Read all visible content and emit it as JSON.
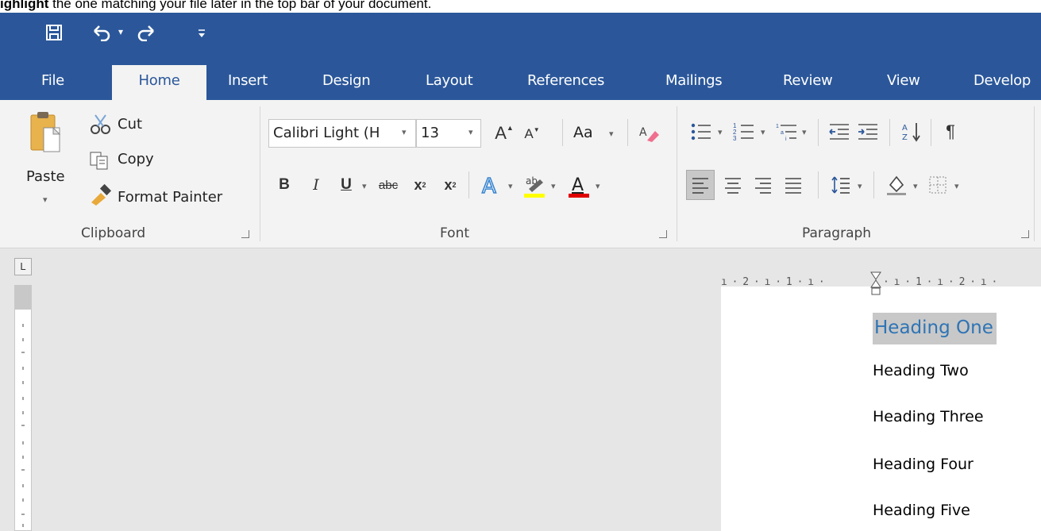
{
  "caption": {
    "bold": "ighlight",
    "rest": " the one matching your file later in the top bar of your document."
  },
  "qat": {
    "items": [
      {
        "name": "save-icon"
      },
      {
        "name": "undo-icon"
      },
      {
        "name": "redo-icon"
      },
      {
        "name": "customize-qat-icon"
      }
    ]
  },
  "tabs": [
    "File",
    "Home",
    "Insert",
    "Design",
    "Layout",
    "References",
    "Mailings",
    "Review",
    "View",
    "Develop"
  ],
  "active_tab": "Home",
  "clipboard": {
    "paste": "Paste",
    "cut": "Cut",
    "copy": "Copy",
    "format_painter": "Format Painter",
    "group_label": "Clipboard"
  },
  "font": {
    "family": "Calibri Light (H",
    "size": "13",
    "change_case": "Aa",
    "group_label": "Font",
    "highlight_color": "#ffff00",
    "font_color": "#e00000"
  },
  "paragraph": {
    "group_label": "Paragraph"
  },
  "ruler": {
    "corner": "L",
    "marks": "ı · 2 · ı · 1 · ı · ",
    "marks_after": "· ı · 1 · ı · 2 · ı ·"
  },
  "document": {
    "lines": [
      "Heading One",
      "Heading Two",
      "Heading Three",
      "Heading Four",
      "Heading Five"
    ]
  }
}
